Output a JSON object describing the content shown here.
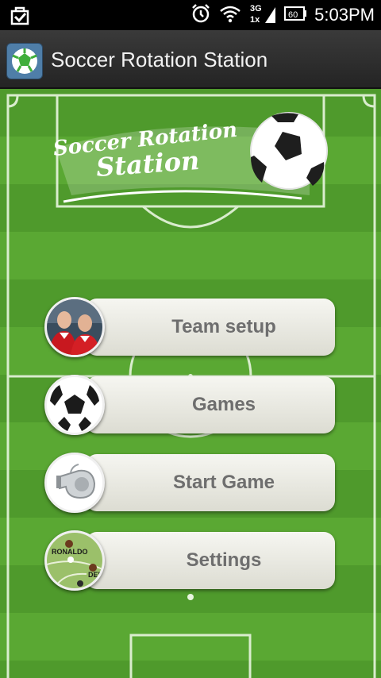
{
  "status_bar": {
    "time": "5:03PM",
    "battery": "60",
    "network": "3G"
  },
  "action_bar": {
    "title": "Soccer Rotation Station"
  },
  "logo": {
    "line1": "Soccer Rotation",
    "line2": "Station"
  },
  "menu": [
    {
      "label": "Team setup",
      "icon": "players-photo-icon"
    },
    {
      "label": "Games",
      "icon": "soccer-ball-icon"
    },
    {
      "label": "Start Game",
      "icon": "whistle-icon"
    },
    {
      "label": "Settings",
      "icon": "lineup-board-icon"
    }
  ],
  "settings_thumb": {
    "name1": "RONALDO",
    "name2": "DEN"
  }
}
